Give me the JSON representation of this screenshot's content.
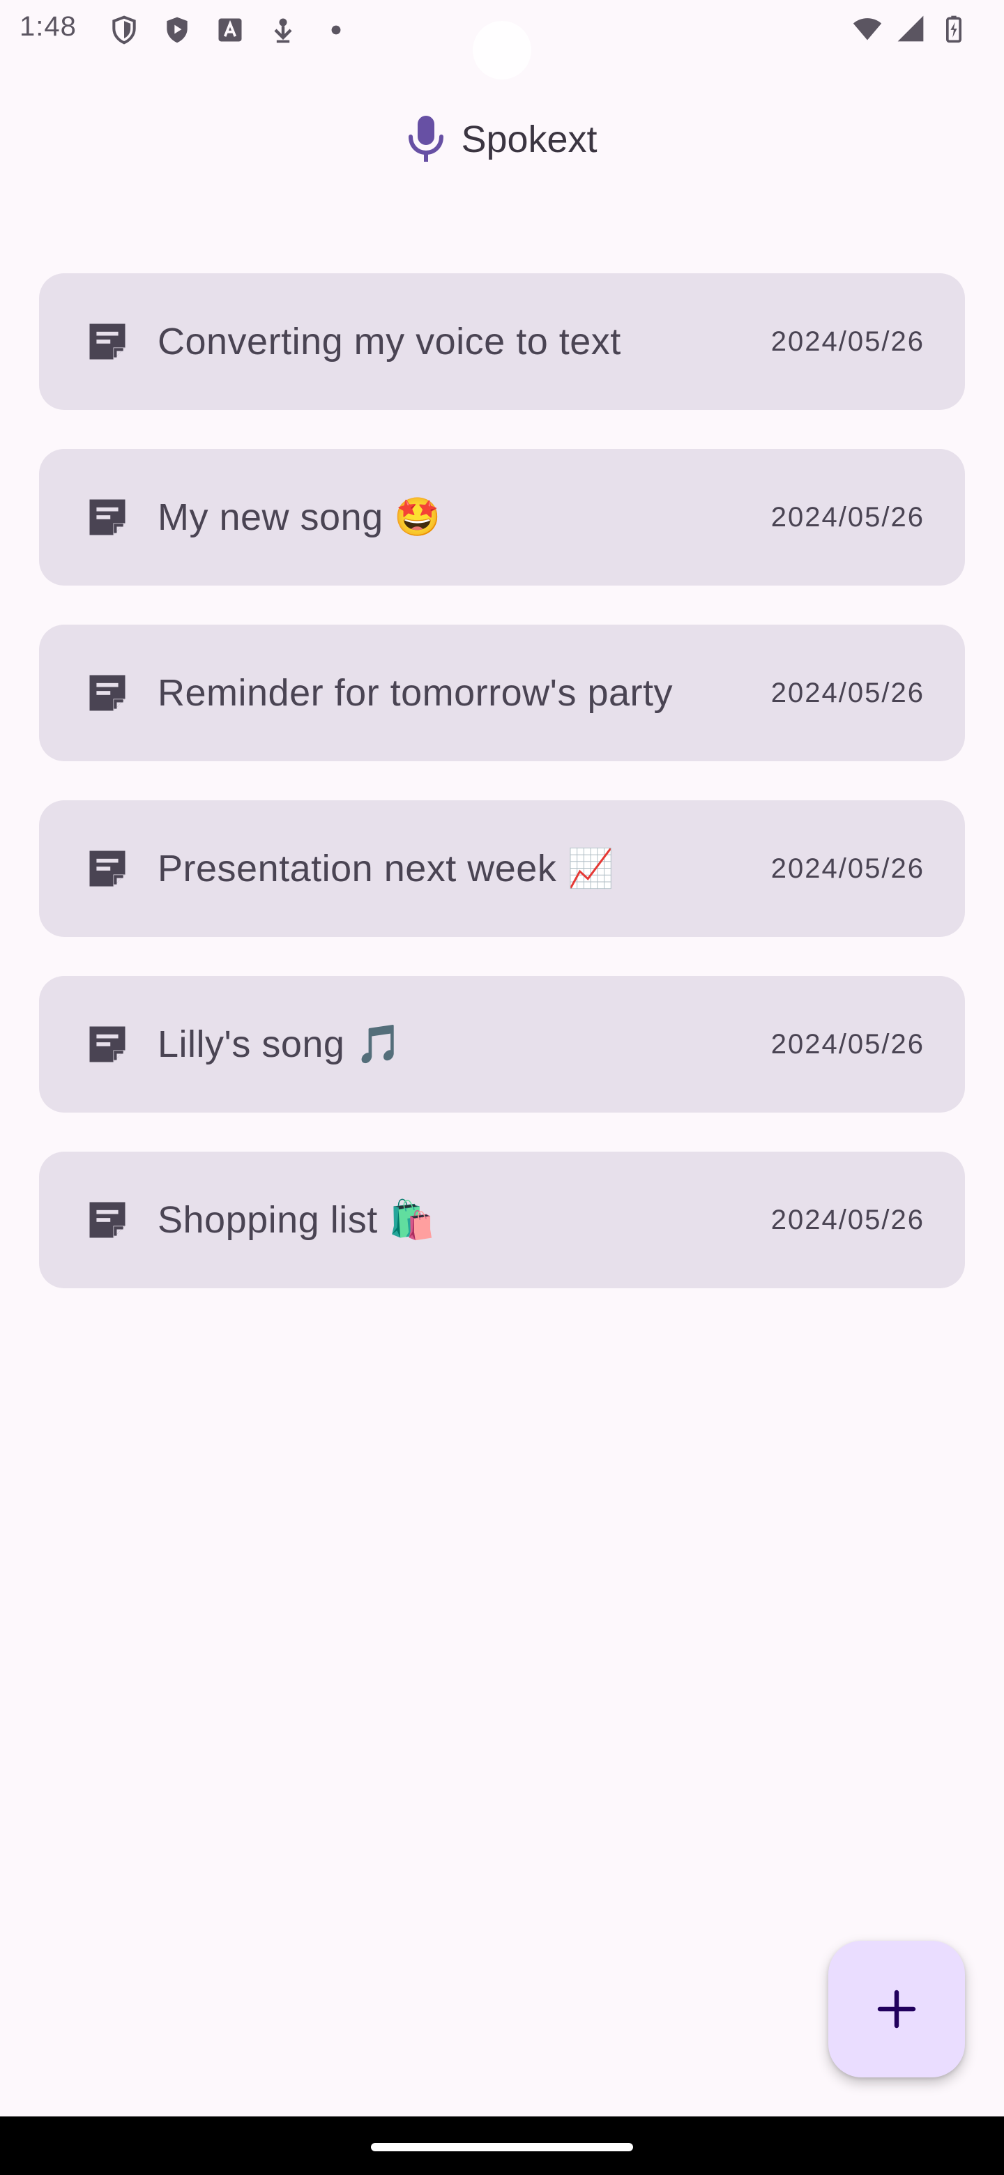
{
  "status_bar": {
    "time": "1:48",
    "left_icons": [
      "shield-icon",
      "play-shield-icon",
      "font-a-icon",
      "download-person-icon",
      "dot-icon"
    ],
    "right_icons": [
      "wifi-icon",
      "cellular-icon",
      "battery-charging-icon"
    ]
  },
  "header": {
    "title": "Spokext",
    "icon": "mic-icon",
    "accent_color": "#6750a4"
  },
  "notes": [
    {
      "title": "Converting my voice to text",
      "date": "2024/05/26"
    },
    {
      "title": "My new song 🤩",
      "date": "2024/05/26"
    },
    {
      "title": "Reminder for tomorrow's party",
      "date": "2024/05/26"
    },
    {
      "title": "Presentation next week 📈",
      "date": "2024/05/26"
    },
    {
      "title": "Lilly's song 🎵",
      "date": "2024/05/26"
    },
    {
      "title": "Shopping list 🛍️",
      "date": "2024/05/26"
    }
  ],
  "fab": {
    "icon": "plus-icon",
    "color": "#eaddff"
  },
  "colors": {
    "background": "#fdf8fc",
    "card": "#e7e0eb",
    "text": "#4a4453"
  }
}
